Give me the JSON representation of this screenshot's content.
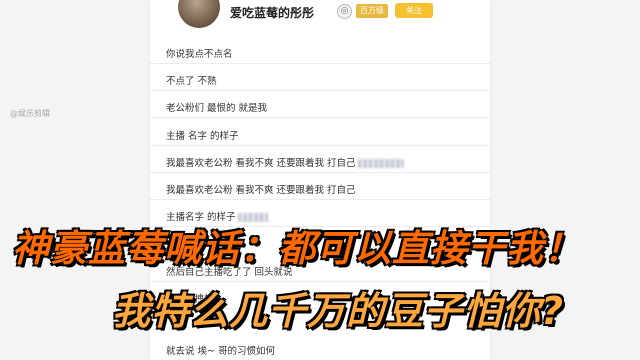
{
  "header": {
    "username": "爱吃蓝莓的彤彤",
    "level_icon": "◎",
    "level_badge": "百万级",
    "follow_label": "关注"
  },
  "messages": [
    "你说我点不点名",
    "不点了 不熟",
    "老公粉们 最恨的 就是我",
    "主播 名字 的样子",
    "我最喜欢老公粉 看我不爽 还要跟着我 打自己",
    "我最喜欢老公粉 看我不爽 还要跟着我 打自己",
    "主播名字 的样子",
    "然后自己主播吃了了 回头就说",
    "要不加拽的",
    "就去说 埃~ 哥的习惯如何"
  ],
  "watermark": "@娱乐剪辑",
  "captions": {
    "line1": "神豪蓝莓喊话：都可以直接干我！",
    "line2": "我特么几千万的豆子怕你?"
  }
}
